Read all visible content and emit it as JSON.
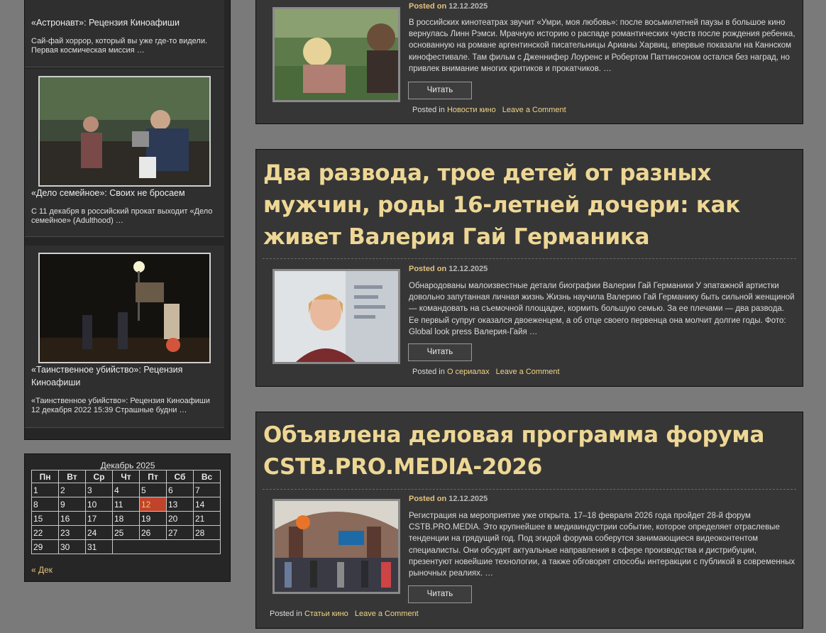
{
  "sidebar": {
    "items": [
      {
        "title": "«Астронавт»: Рецензия Киноафиши",
        "excerpt": "Сай-фай хоррор, который вы уже где-то видели. Первая космическая миссия …"
      },
      {
        "title": "«Дело семейное»: Своих не бросаем",
        "excerpt": "С 11 декабря в российский прокат выходит «Дело семейное» (Adulthood) …"
      },
      {
        "title": "«Таинственное убийство»: Рецензия Киноафиши",
        "excerpt": "«Таинственное убийство»: Рецензия Киноафиши 12 декабря 2022 15:39 Страшные будни …"
      }
    ]
  },
  "calendar": {
    "caption": "Декабрь 2025",
    "weekdays": [
      "Пн",
      "Вт",
      "Ср",
      "Чт",
      "Пт",
      "Сб",
      "Вс"
    ],
    "weeks": [
      [
        "1",
        "2",
        "3",
        "4",
        "5",
        "6",
        "7"
      ],
      [
        "8",
        "9",
        "10",
        "11",
        "12",
        "13",
        "14"
      ],
      [
        "15",
        "16",
        "17",
        "18",
        "19",
        "20",
        "21"
      ],
      [
        "22",
        "23",
        "24",
        "25",
        "26",
        "27",
        "28"
      ],
      [
        "29",
        "30",
        "31",
        "",
        "",
        "",
        ""
      ]
    ],
    "today": "12",
    "prev_link": "« Дек"
  },
  "posts": [
    {
      "title": "",
      "meta_label": "Posted on",
      "date": "12.12.2025",
      "excerpt": "В российских кинотеатрах звучит «Умри, моя любовь»: после восьмилетней паузы в большое кино вернулась Линн Рэмси. Мрачную историю о распаде романтических чувств после рождения ребенка, основанную на романе аргентинской писательницы Арианы Харвиц, впервые показали на Каннском кинофестивале. Там фильм с Дженнифер Лоуренс и Робертом Паттинсоном остался без наград, но привлек внимание многих критиков и прокатчиков. …",
      "read_label": "Читать",
      "posted_in": "Posted in",
      "category": "Новости кино",
      "comment": "Leave a Comment"
    },
    {
      "title": "Два развода, трое детей от разных мужчин, роды 16-летней дочери: как живет Валерия Гай Германика",
      "meta_label": "Posted on",
      "date": "12.12.2025",
      "excerpt": "Обнародованы малоизвестные детали биографии Валерии Гай Германики У эпатажной артистки довольно запутанная личная жизнь Жизнь научила Валерию Гай Германику быть сильной женщиной — командовать на съемочной площадке, кормить большую семью. За ее плечами — два развода. Ее первый супруг оказался двоеженцем, а об отце своего первенца она молчит долгие годы. Фото: Global look press Валерия-Гайя …",
      "read_label": "Читать",
      "posted_in": "Posted in",
      "category": "О сериалах",
      "comment": "Leave a Comment"
    },
    {
      "title": "Объявлена деловая программа форума CSTB.PRO.MEDIA-2026",
      "meta_label": "Posted on",
      "date": "12.12.2025",
      "excerpt": "Регистрация на мероприятие уже открыта. 17–18 февраля 2026 года пройдет 28-й форум CSTB.PRO.MEDIA. Это крупнейшее в медиаиндустрии событие, которое определяет отраслевые тенденции на грядущий год. Под эгидой форума соберутся занимающиеся видеоконтентом специалисты. Они обсудят актуальные направления в сфере производства и дистрибуции, презентуют новейшие технологии, а также обговорят способы интеракции с публикой в современных рыночных реалиях. …",
      "read_label": "Читать",
      "posted_in": "Posted in",
      "category": "Статьи кино",
      "comment": "Leave a Comment"
    }
  ]
}
